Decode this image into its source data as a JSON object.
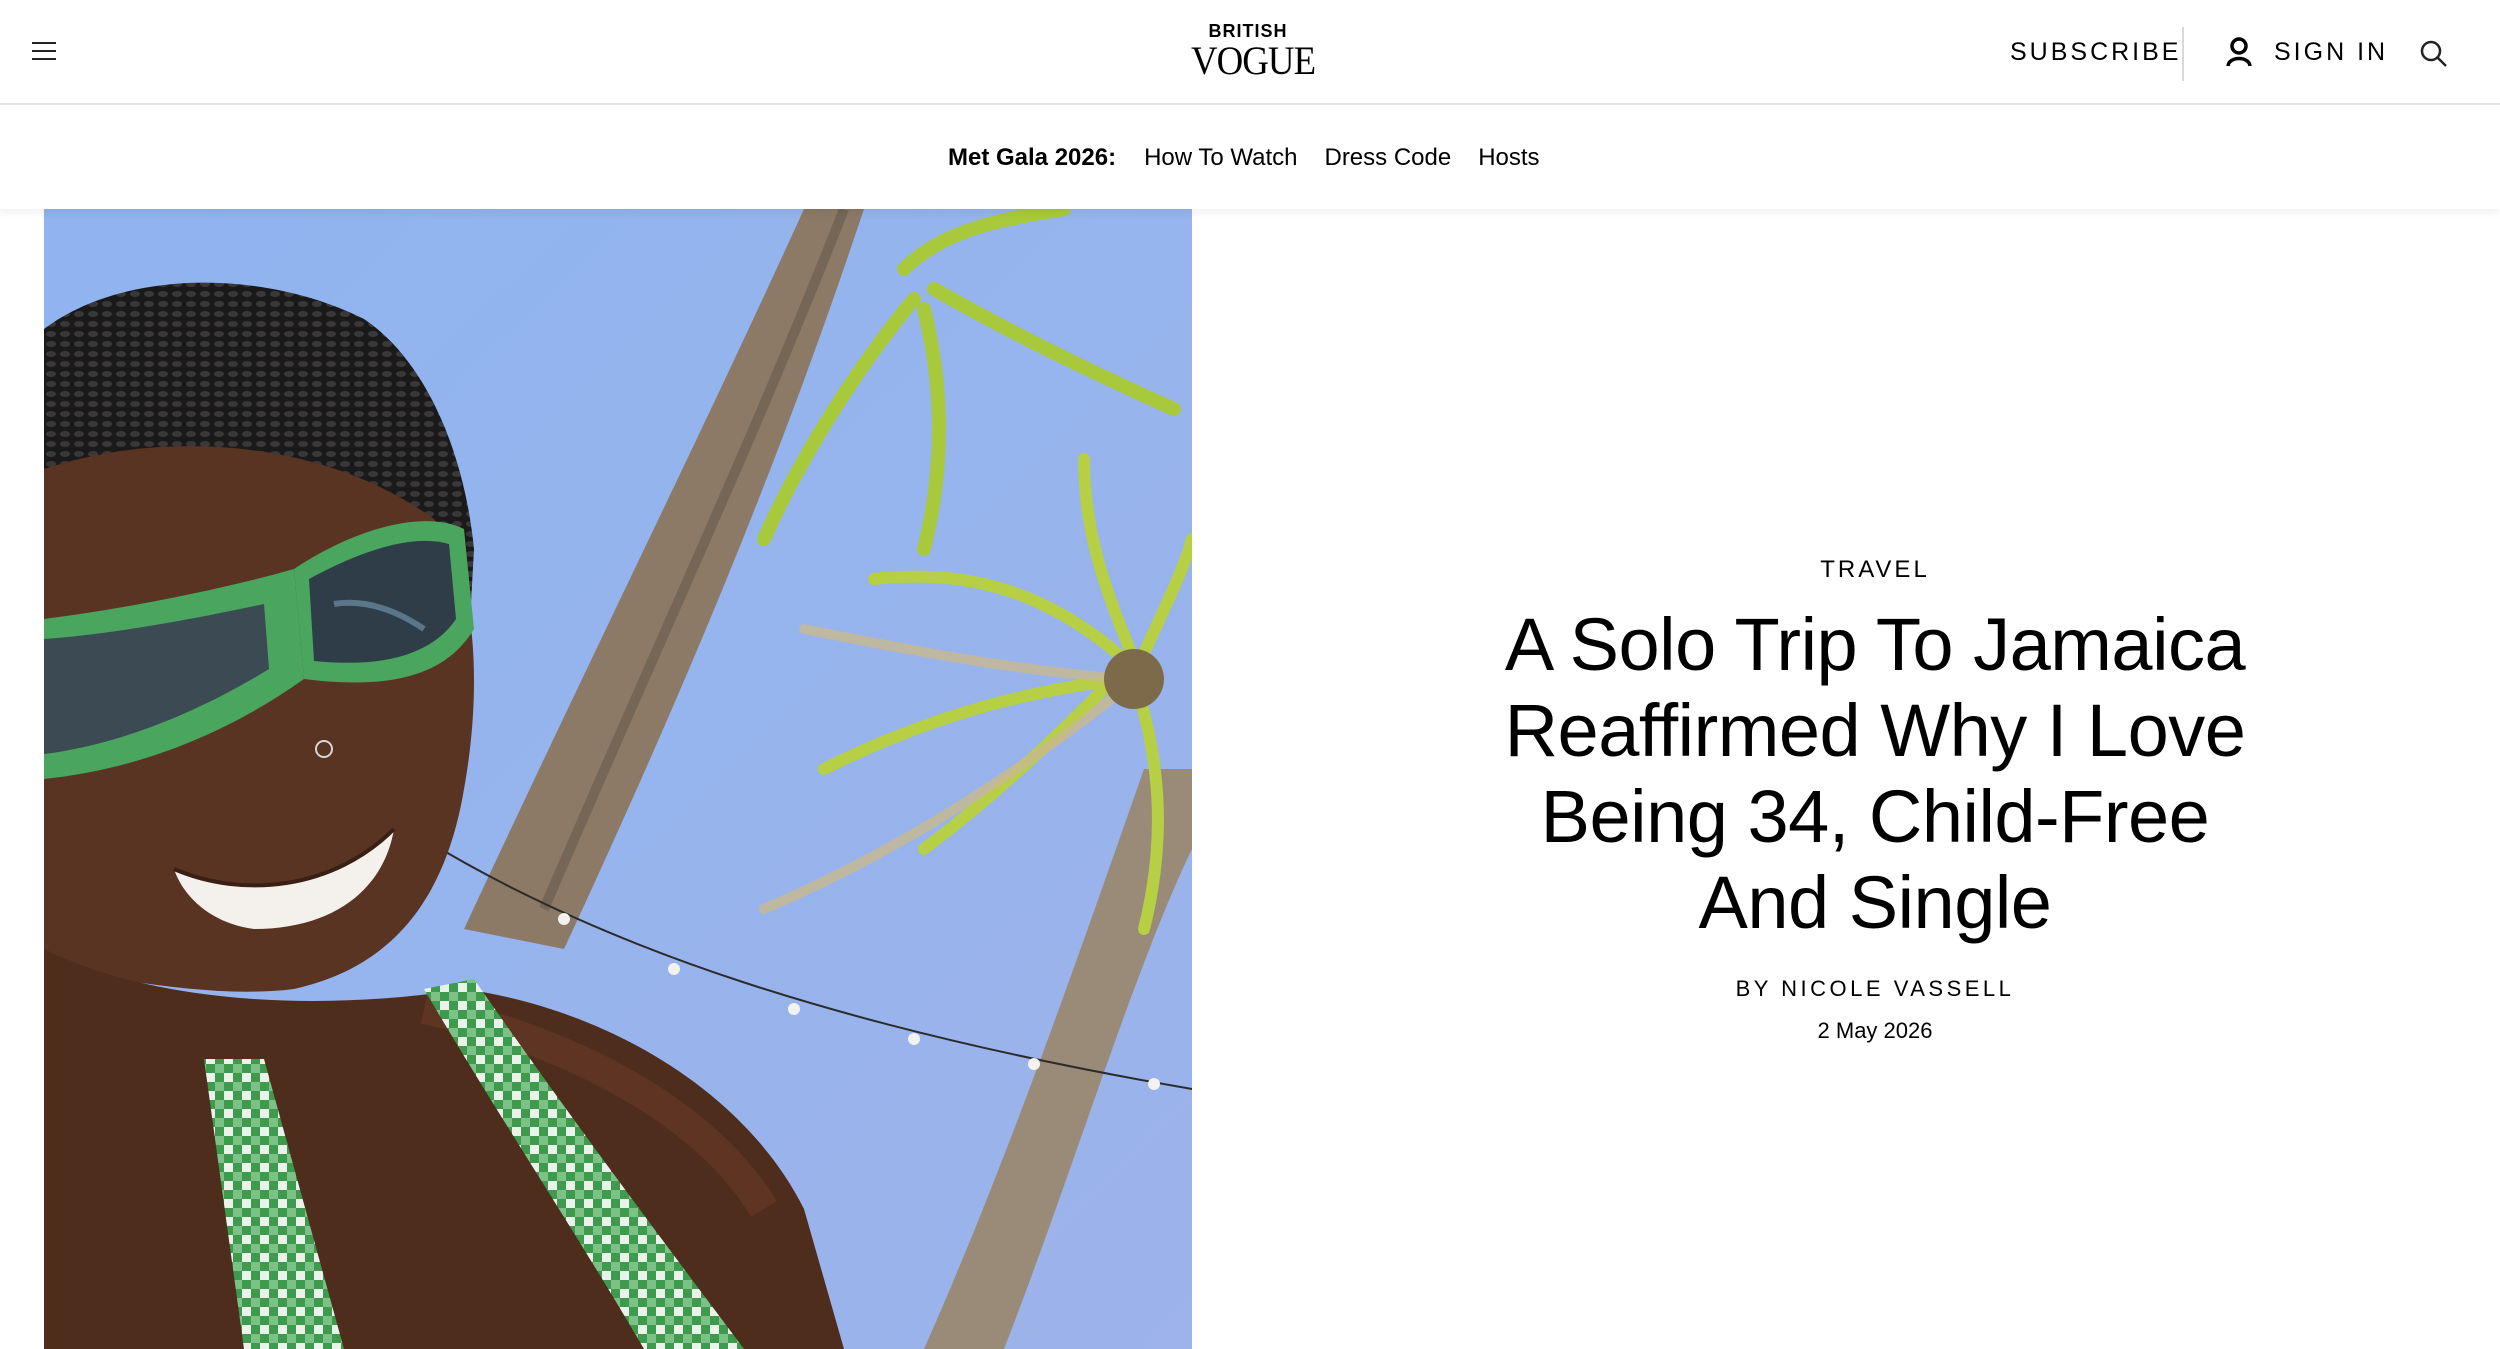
{
  "header": {
    "menu_icon": "hamburger-menu-icon",
    "logo_top": "BRITISH",
    "logo_main": "VOGUE",
    "subscribe_label": "SUBSCRIBE",
    "signin_label": "SIGN IN",
    "signin_icon": "user-icon",
    "search_icon": "search-icon"
  },
  "subnav": {
    "label": "Met Gala 2026:",
    "links": [
      "How To Watch",
      "Dress Code",
      "Hosts"
    ]
  },
  "article": {
    "rubric": "TRAVEL",
    "headline_lines": [
      "A Solo Trip To Jamaica",
      "Reaffirmed Why I Love",
      "Being 34, Child-Free",
      "And Single"
    ],
    "byline_prefix": "BY",
    "author": "NICOLE VASSELL",
    "date": "2 May 2026"
  },
  "hero_image": {
    "subject": "woman-in-green-sunglasses-under-palm-trees",
    "colors": {
      "sky": "#8fb0ec",
      "skin": "#5a3422",
      "glasses": "#4aa55e",
      "palm_leaf": "#a9c93c",
      "trunk": "#8c7a66",
      "swimsuit": "#3e9a4c"
    }
  }
}
